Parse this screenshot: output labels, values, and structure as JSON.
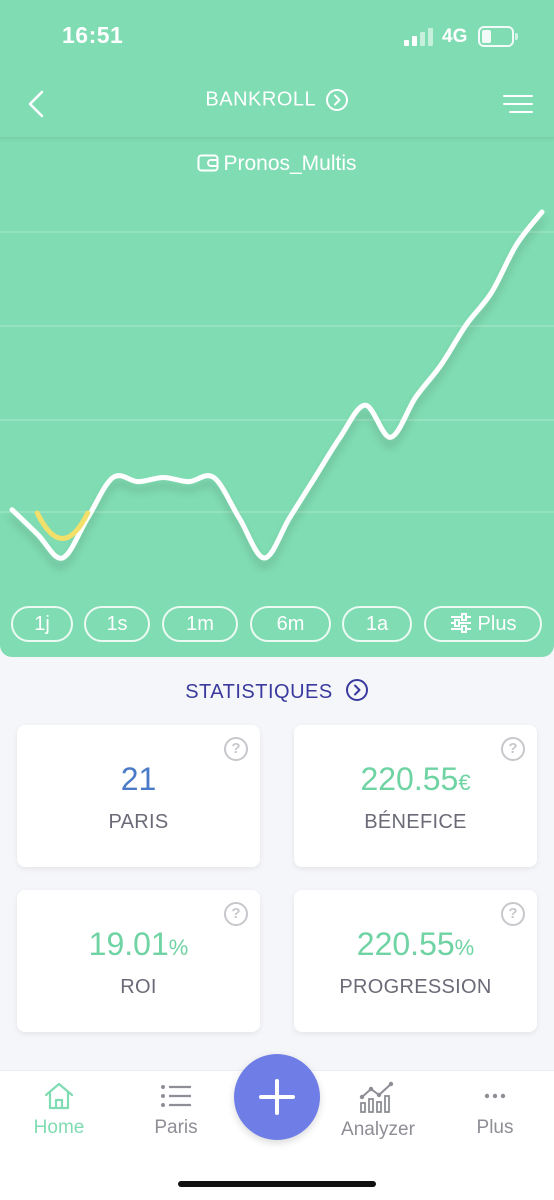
{
  "status_bar": {
    "time": "16:51",
    "network": "4G"
  },
  "header": {
    "title": "BANKROLL"
  },
  "bankroll": {
    "name": "Pronos_Multis"
  },
  "chart_data": {
    "type": "line",
    "x": [
      0,
      1,
      2,
      3,
      4,
      5,
      6,
      7,
      8,
      9,
      10,
      11,
      12,
      13,
      14,
      15,
      16,
      17,
      18,
      19,
      20,
      21
    ],
    "values": [
      60,
      30,
      0,
      50,
      100,
      95,
      100,
      95,
      100,
      50,
      0,
      50,
      100,
      150,
      190,
      150,
      200,
      240,
      290,
      330,
      390,
      430
    ],
    "colors": {
      "line": "#ffffff",
      "negative": "#f2e06b",
      "background": "#80dcb2"
    }
  },
  "ranges": [
    {
      "label": "1j"
    },
    {
      "label": "1s"
    },
    {
      "label": "1m"
    },
    {
      "label": "6m"
    },
    {
      "label": "1a"
    },
    {
      "label": "Plus",
      "icon": "sliders-icon"
    }
  ],
  "stats": {
    "heading": "STATISTIQUES",
    "cards": [
      {
        "value": "21",
        "unit": "",
        "label": "PARIS",
        "color": "#4a7ac8"
      },
      {
        "value": "220.55",
        "unit": "€",
        "label": "BÉNEFICE",
        "color": "#6fd3a3"
      },
      {
        "value": "19.01",
        "unit": "%",
        "label": "ROI",
        "color": "#6fd3a3"
      },
      {
        "value": "220.55",
        "unit": "%",
        "label": "PROGRESSION",
        "color": "#6fd3a3"
      }
    ],
    "help_glyph": "?"
  },
  "tabbar": {
    "items": [
      {
        "label": "Home",
        "icon": "home-icon",
        "active": true
      },
      {
        "label": "Paris",
        "icon": "list-icon",
        "active": false
      },
      {
        "label": "Analyzer",
        "icon": "analyzer-icon",
        "active": false
      },
      {
        "label": "Plus",
        "icon": "more-icon",
        "active": false
      }
    ],
    "fab_icon": "plus-icon"
  },
  "colors": {
    "accent": "#80dcb2",
    "fab": "#6f7de6",
    "heading": "#3a3a9e"
  }
}
